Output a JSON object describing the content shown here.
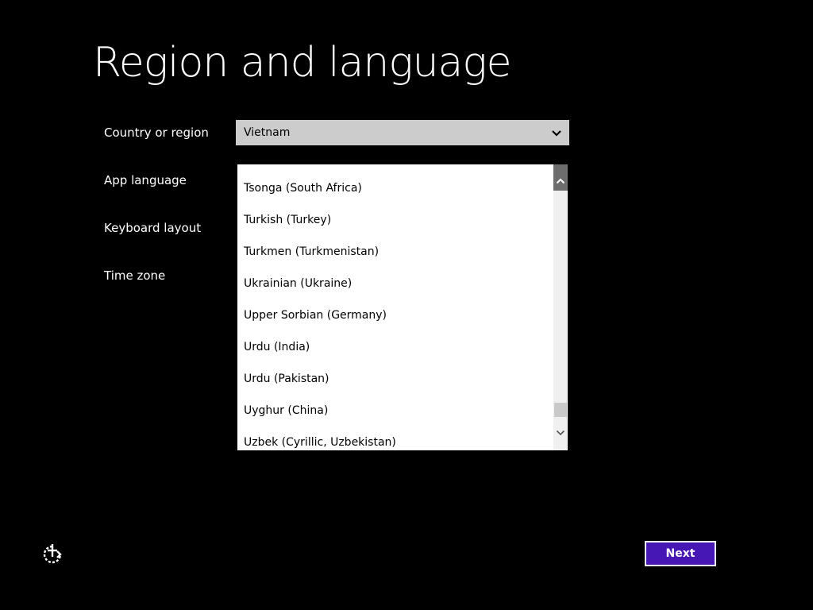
{
  "page": {
    "title": "Region and language"
  },
  "form": {
    "country_label": "Country or region",
    "country_value": "Vietnam",
    "app_language_label": "App language",
    "keyboard_layout_label": "Keyboard layout",
    "time_zone_label": "Time zone"
  },
  "language_list": {
    "items": [
      "Tsonga (South Africa)",
      "Turkish (Turkey)",
      "Turkmen (Turkmenistan)",
      "Ukrainian (Ukraine)",
      "Upper Sorbian (Germany)",
      "Urdu (India)",
      "Urdu (Pakistan)",
      "Uyghur (China)",
      "Uzbek (Cyrillic, Uzbekistan)"
    ]
  },
  "footer": {
    "next_label": "Next"
  },
  "colors": {
    "background": "#000000",
    "accent": "#4617b4",
    "select_bg": "#cccccc"
  },
  "icons": {
    "country_chevron": "chevron-down-icon",
    "scroll_up": "chevron-up-icon",
    "scroll_down": "chevron-down-icon",
    "accessibility": "ease-of-access-icon"
  }
}
